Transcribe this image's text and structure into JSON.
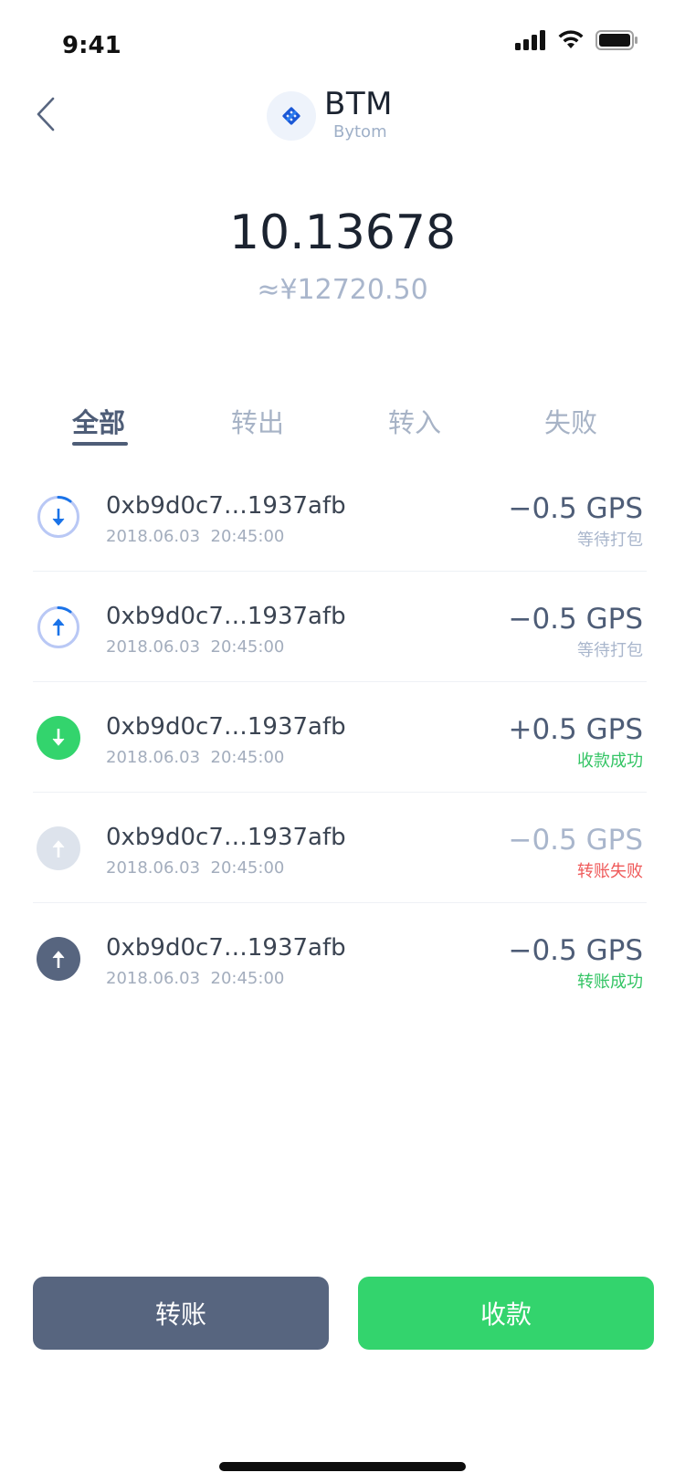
{
  "status_bar": {
    "time": "9:41",
    "icons": [
      "signal-icon",
      "wifi-icon",
      "battery-icon"
    ]
  },
  "nav": {
    "back_icon": "chevron-left-icon",
    "coin_symbol": "BTM",
    "coin_name": "Bytom",
    "logo_icon": "bytom-logo-icon"
  },
  "balance": {
    "amount": "10.13678",
    "fiat": "≈¥12720.50"
  },
  "tabs": [
    {
      "label": "全部",
      "active": true
    },
    {
      "label": "转出",
      "active": false
    },
    {
      "label": "转入",
      "active": false
    },
    {
      "label": "失败",
      "active": false
    }
  ],
  "transactions": [
    {
      "address": "0xb9d0c7…1937afb",
      "date": "2018.06.03",
      "time": "20:45:00",
      "amount": "−0.5 GPS",
      "status": "等待打包",
      "icon": "pending-receive-icon",
      "status_color": "#a9b6cc",
      "amount_color": "#4e5d77"
    },
    {
      "address": "0xb9d0c7…1937afb",
      "date": "2018.06.03",
      "time": "20:45:00",
      "amount": "−0.5 GPS",
      "status": "等待打包",
      "icon": "pending-send-icon",
      "status_color": "#a9b6cc",
      "amount_color": "#4e5d77"
    },
    {
      "address": "0xb9d0c7…1937afb",
      "date": "2018.06.03",
      "time": "20:45:00",
      "amount": "+0.5 GPS",
      "status": "收款成功",
      "icon": "receive-success-icon",
      "status_color": "#33c464",
      "amount_color": "#4e5d77"
    },
    {
      "address": "0xb9d0c7…1937afb",
      "date": "2018.06.03",
      "time": "20:45:00",
      "amount": "−0.5 GPS",
      "status": "转账失败",
      "icon": "send-failed-icon",
      "status_color": "#ef5a5a",
      "amount_color": "#a9b6cc"
    },
    {
      "address": "0xb9d0c7…1937afb",
      "date": "2018.06.03",
      "time": "20:45:00",
      "amount": "−0.5 GPS",
      "status": "转账成功",
      "icon": "send-success-icon",
      "status_color": "#33c464",
      "amount_color": "#4e5d77"
    }
  ],
  "actions": {
    "transfer_label": "转账",
    "receive_label": "收款"
  },
  "colors": {
    "accent_green": "#33d46d",
    "slate": "#57657f",
    "pending_blue": "#1a73e8",
    "failed_red": "#ef5a5a"
  }
}
